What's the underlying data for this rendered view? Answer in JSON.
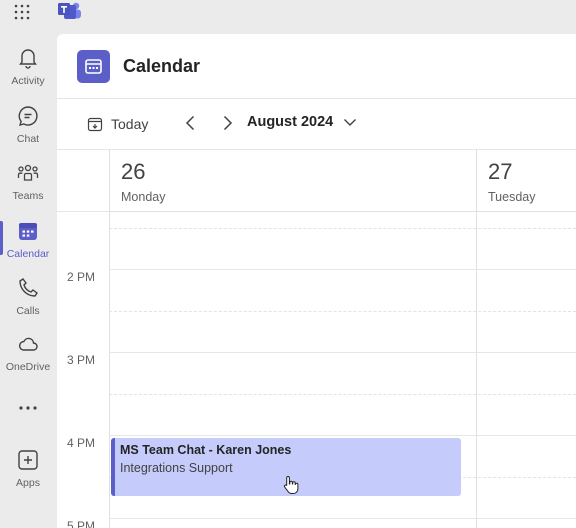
{
  "colors": {
    "accent": "#5b5fc7",
    "event_bg": "#c5cbfa",
    "rail_bg": "#ebebeb"
  },
  "rail": {
    "items": [
      {
        "label": "Activity",
        "icon": "bell-icon"
      },
      {
        "label": "Chat",
        "icon": "chat-icon"
      },
      {
        "label": "Teams",
        "icon": "teams-icon"
      },
      {
        "label": "Calendar",
        "icon": "calendar-icon",
        "active": true
      },
      {
        "label": "Calls",
        "icon": "phone-icon"
      },
      {
        "label": "OneDrive",
        "icon": "cloud-icon"
      },
      {
        "label": "",
        "icon": "more-icon"
      },
      {
        "label": "Apps",
        "icon": "plus-box-icon"
      }
    ]
  },
  "header": {
    "title": "Calendar"
  },
  "toolbar": {
    "today_label": "Today",
    "month_label": "August 2024"
  },
  "days": [
    {
      "number": "26",
      "name": "Monday"
    },
    {
      "number": "27",
      "name": "Tuesday"
    }
  ],
  "times": [
    "2 PM",
    "3 PM",
    "4 PM",
    "5 PM"
  ],
  "event": {
    "title": "MS Team Chat - Karen Jones",
    "subtitle": "Integrations Support"
  }
}
